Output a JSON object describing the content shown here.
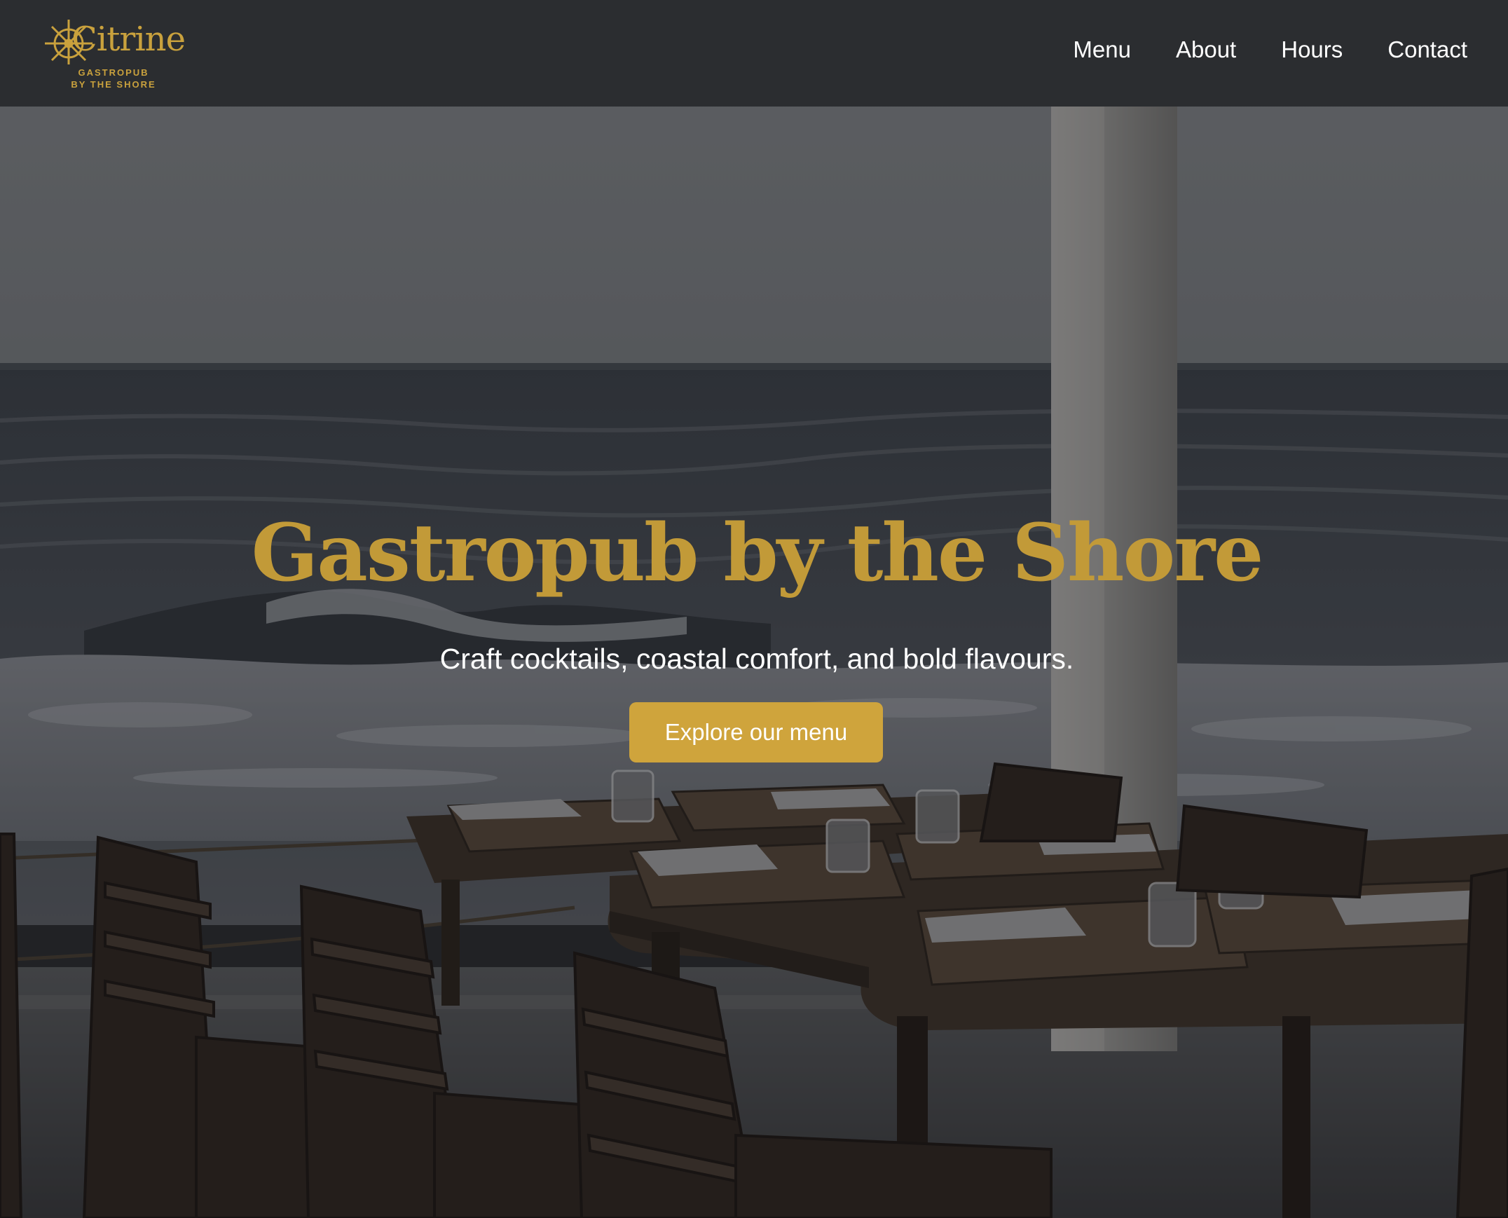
{
  "brand": {
    "name": "Citrine",
    "tagline_line1": "GASTROPUB",
    "tagline_line2": "BY THE SHORE",
    "logo_icon": "ships-wheel-icon",
    "accent_color": "#c9a13d"
  },
  "nav": {
    "items": [
      {
        "label": "Menu"
      },
      {
        "label": "About"
      },
      {
        "label": "Hours"
      },
      {
        "label": "Contact"
      }
    ]
  },
  "hero": {
    "title": "Gastropub by the Shore",
    "subtitle": "Craft cocktails, coastal comfort, and bold flavours.",
    "cta_label": "Explore our menu",
    "background_image": "seaside-terrace-photo"
  },
  "colors": {
    "header_bg": "#2b2d30",
    "title_color": "#c29a38",
    "cta_bg": "#cfa43c",
    "text_light": "#ffffff"
  }
}
